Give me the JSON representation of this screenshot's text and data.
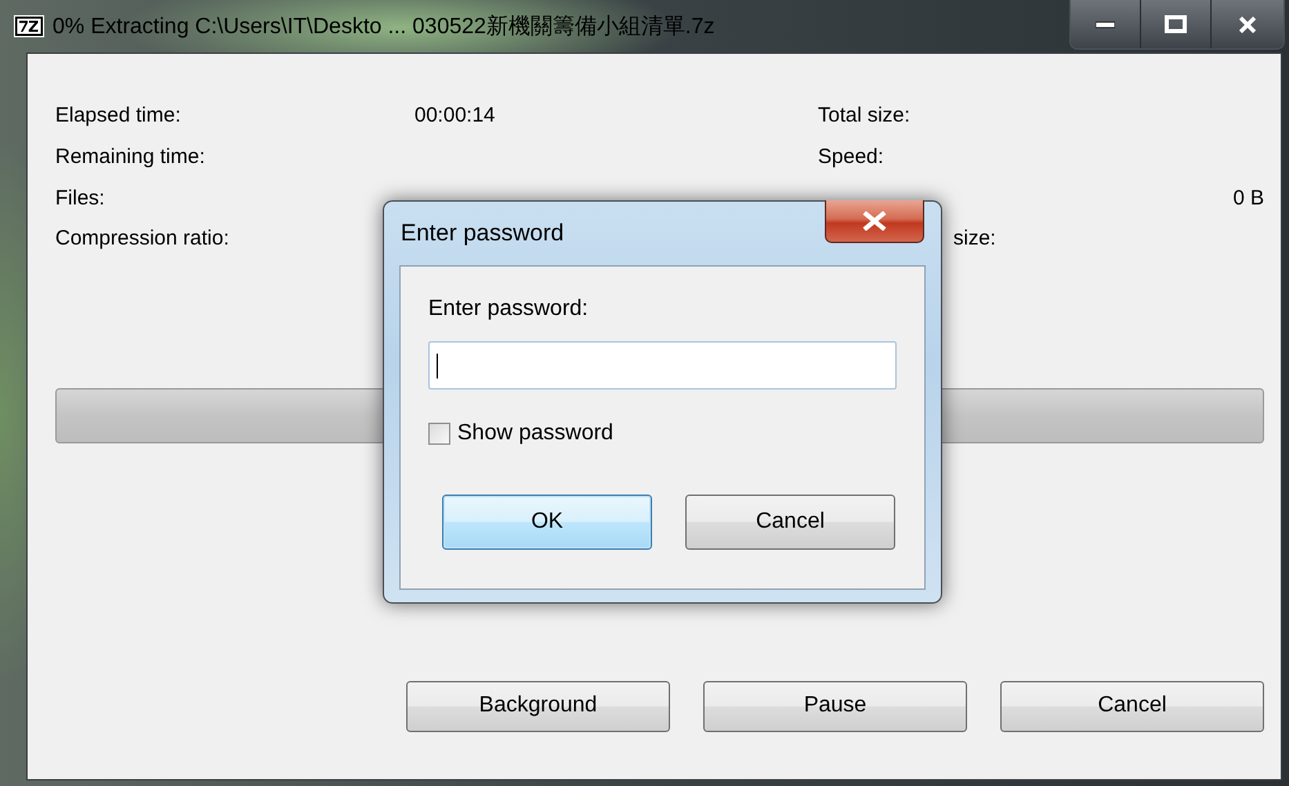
{
  "window": {
    "title": "0% Extracting C:\\Users\\IT\\Deskto ... 030522新機關籌備小組清單.7z"
  },
  "stats": [
    {
      "label": "Elapsed time:",
      "value": "00:00:14",
      "right_label": "Total size:"
    },
    {
      "label": "Remaining time:",
      "right_label": "Speed:"
    },
    {
      "label": "Files:",
      "right_value": "0 B"
    },
    {
      "label": "Compression ratio:",
      "right_label_tail": "size:"
    }
  ],
  "progress": {
    "level": 0
  },
  "buttons": [
    "Background",
    "Pause",
    "Cancel"
  ],
  "dialog": {
    "title": "Enter password",
    "prompt": "Enter password:",
    "field": {
      "focused": true
    },
    "show_password": {
      "label": "Show password",
      "checked": false
    },
    "buttons": [
      {
        "label": "OK",
        "default": true
      },
      {
        "label": "Cancel",
        "default": false
      }
    ]
  }
}
